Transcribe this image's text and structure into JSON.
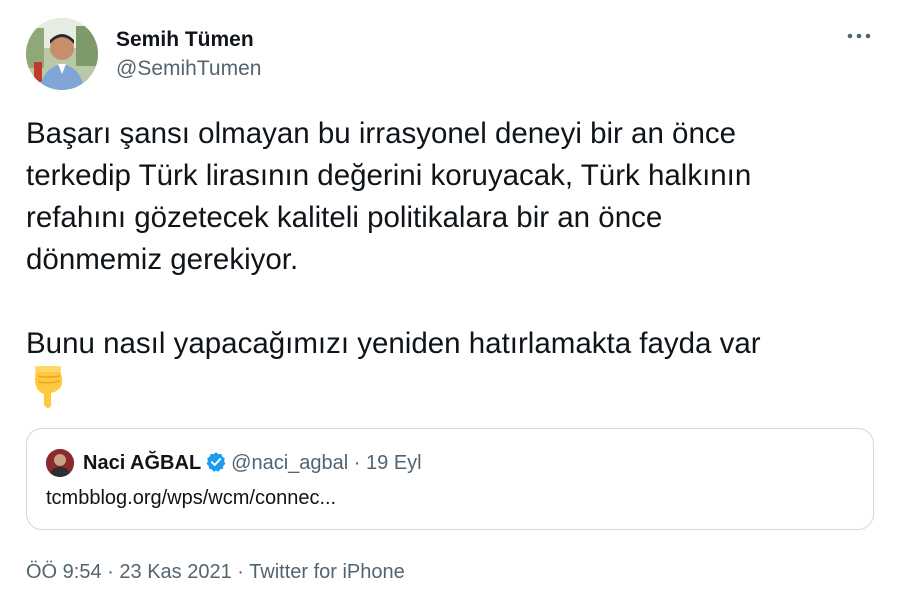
{
  "author": {
    "display_name": "Semih Tümen",
    "handle": "@SemihTumen",
    "avatar_icon": "person-photo"
  },
  "more_icon": "more-horizontal-icon",
  "tweet": {
    "text": "Başarı şansı olmayan bu irrasyonel deneyi bir an önce\nterkedip Türk lirasının değerini koruyacak, Türk halkının\nrefahını gözetecek kaliteli politikalara bir an önce\ndönmemiz gerekiyor.\n\nBunu nasıl yapacağımızı yeniden hatırlamakta fayda var",
    "emoji": "backhand-index-pointing-down"
  },
  "quoted_tweet": {
    "display_name": "Naci AĞBAL",
    "verified_icon": "verified-badge-icon",
    "handle": "@naci_agbal",
    "separator": " · ",
    "date": "19 Eyl",
    "link_text": "tcmbblog.org/wps/wcm/connec..."
  },
  "footer": {
    "time": "ÖÖ 9:54",
    "sep1": " · ",
    "date": "23 Kas 2021",
    "sep2": " · ",
    "source": "Twitter for iPhone"
  },
  "colors": {
    "text_primary": "#0f1419",
    "text_secondary": "#536471",
    "border": "#cfd9de",
    "verified_blue": "#1d9bf0",
    "emoji_yellow": "#ffc83d"
  }
}
